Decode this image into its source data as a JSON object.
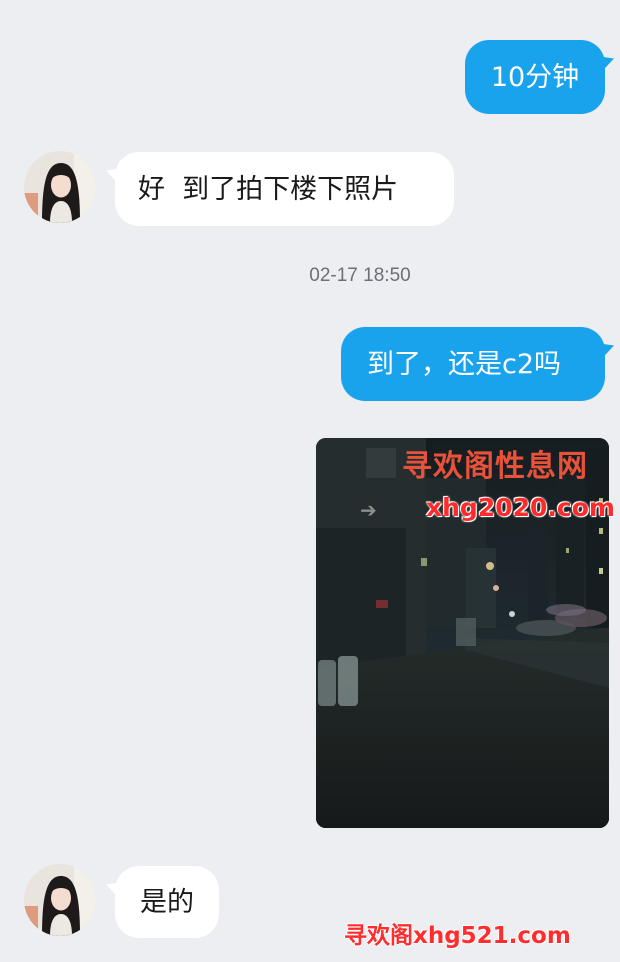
{
  "messages": {
    "m1": {
      "text": "10分钟",
      "direction": "outgoing"
    },
    "m2": {
      "text": "好  到了拍下楼下照片",
      "direction": "incoming"
    },
    "timestamp": "02-17 18:50",
    "m3": {
      "text": "到了，还是c2吗",
      "direction": "outgoing"
    },
    "m4": {
      "type": "image",
      "direction": "outgoing",
      "description": "night street photo"
    },
    "m5": {
      "text": "是的",
      "direction": "incoming"
    }
  },
  "watermarks": {
    "title": "寻欢阁性息网",
    "domain": "xhg2020.com",
    "arrow": "➔",
    "bottom": "寻欢阁xhg521.com"
  },
  "colors": {
    "background": "#eceef2",
    "outgoing_bubble": "#19a3ec",
    "incoming_bubble": "#ffffff",
    "watermark_red": "#ff2a2a"
  }
}
